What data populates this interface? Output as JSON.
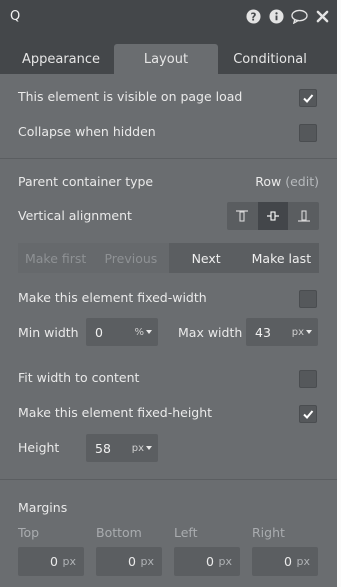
{
  "window": {
    "title": "Q"
  },
  "tabs": [
    {
      "label": "Appearance"
    },
    {
      "label": "Layout"
    },
    {
      "label": "Conditional"
    }
  ],
  "visibility": {
    "visible_on_load_label": "This element is visible on page load",
    "visible_on_load_checked": true,
    "collapse_label": "Collapse when hidden",
    "collapse_checked": false
  },
  "container": {
    "type_label": "Parent container type",
    "type_value": "Row",
    "type_edit": "(edit)",
    "valign_label": "Vertical alignment"
  },
  "order_buttons": [
    {
      "label": "Make first"
    },
    {
      "label": "Previous"
    },
    {
      "label": "Next"
    },
    {
      "label": "Make last"
    }
  ],
  "width": {
    "fixed_label": "Make this element fixed-width",
    "fixed_checked": false,
    "min_label": "Min width",
    "min_value": "0",
    "min_unit": "%",
    "max_label": "Max width",
    "max_value": "43",
    "max_unit": "px",
    "fit_label": "Fit width to content",
    "fit_checked": false
  },
  "height": {
    "fixed_label": "Make this element fixed-height",
    "fixed_checked": true,
    "label": "Height",
    "value": "58",
    "unit": "px"
  },
  "margins": {
    "title": "Margins",
    "fields": [
      {
        "label": "Top",
        "value": "0",
        "unit": "px"
      },
      {
        "label": "Bottom",
        "value": "0",
        "unit": "px"
      },
      {
        "label": "Left",
        "value": "0",
        "unit": "px"
      },
      {
        "label": "Right",
        "value": "0",
        "unit": "px"
      }
    ]
  }
}
